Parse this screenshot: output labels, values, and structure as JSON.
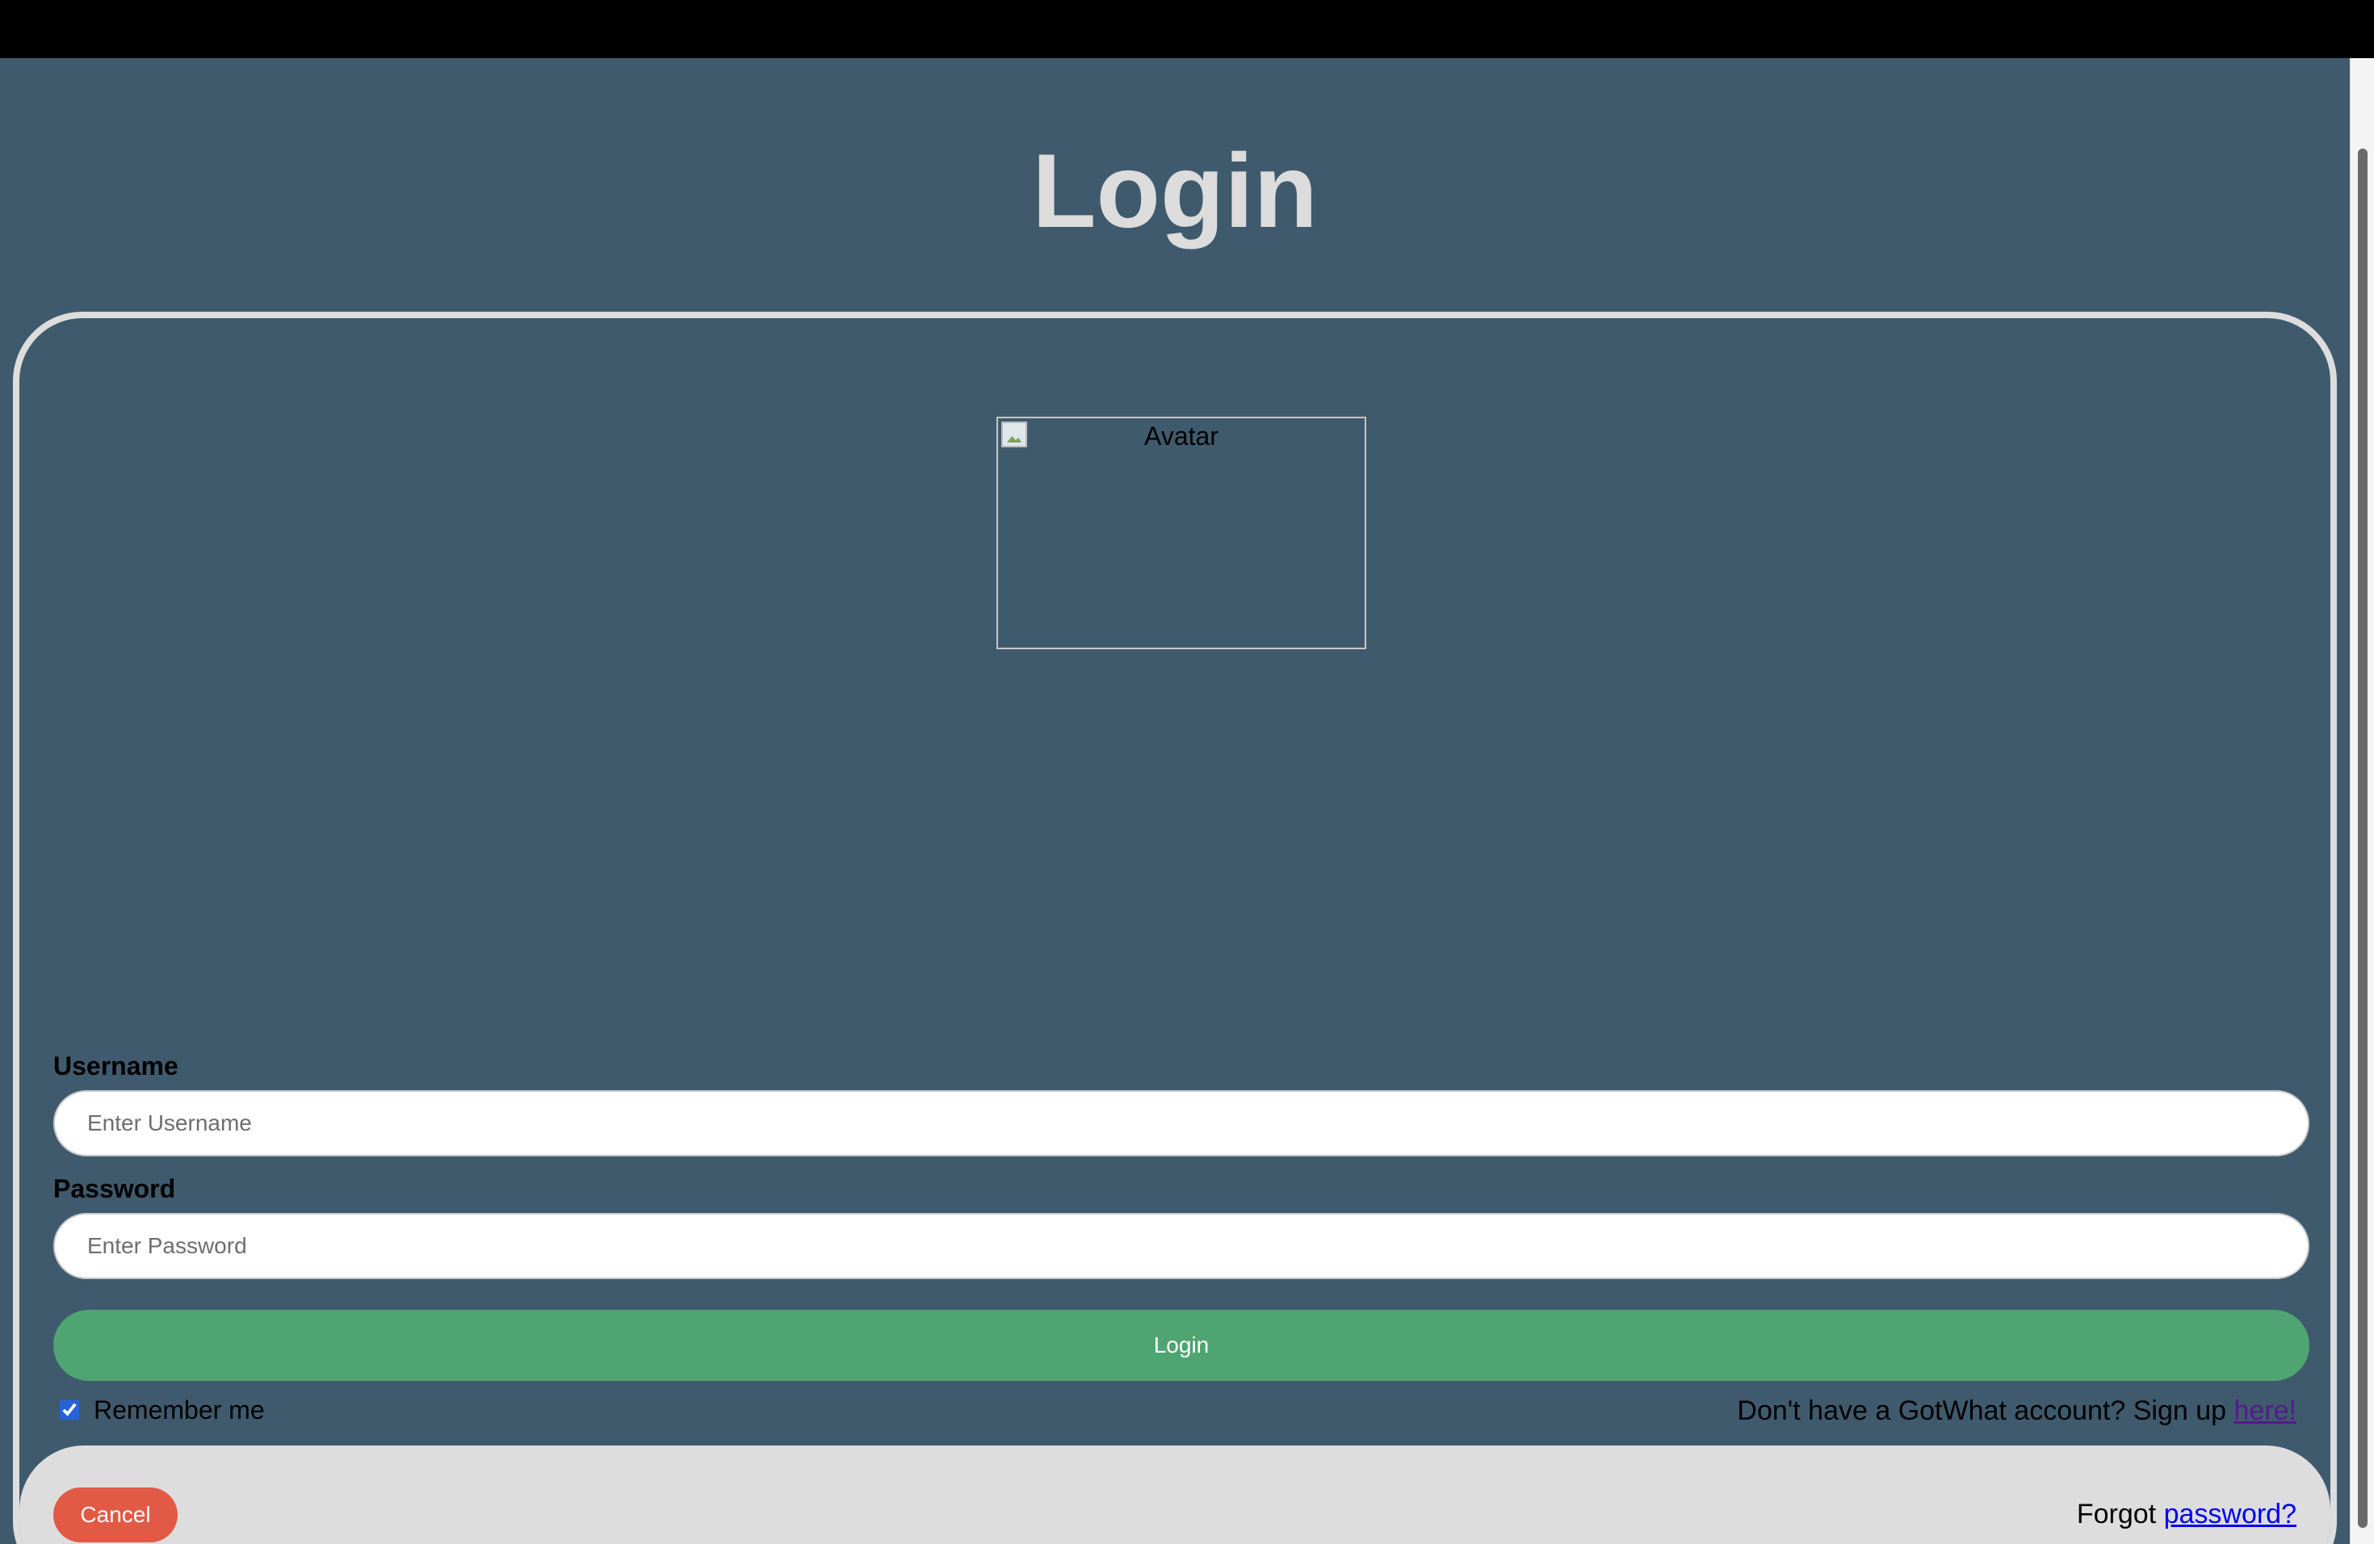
{
  "page": {
    "title": "Login"
  },
  "avatar": {
    "alt": "Avatar"
  },
  "form": {
    "username_label": "Username",
    "username_placeholder": "Enter Username",
    "username_value": "",
    "password_label": "Password",
    "password_placeholder": "Enter Password",
    "password_value": "",
    "login_label": "Login",
    "remember_label": "Remember me",
    "remember_checked": true,
    "signup_prefix": "Don't have a GotWhat account? Sign up ",
    "signup_link": "here!"
  },
  "footer": {
    "cancel_label": "Cancel",
    "forgot_prefix": "Forgot ",
    "forgot_link": "password?"
  },
  "colors": {
    "background": "#3f5a6d",
    "title": "#dcdcdc",
    "login_button": "#4fa572",
    "cancel_button": "#e25a45",
    "footer": "#dddddd",
    "visited_link": "#551a8b",
    "link": "#0000ee"
  }
}
